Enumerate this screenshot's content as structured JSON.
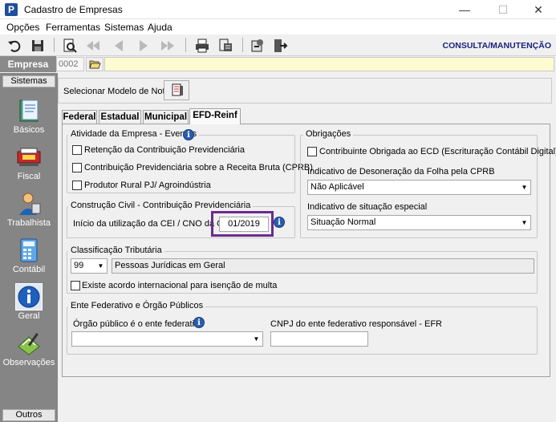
{
  "window": {
    "title": "Cadastro de Empresas",
    "app_icon_letter": "P",
    "minimize": "—",
    "maximize": "☐",
    "close": "✕"
  },
  "menu": {
    "items": [
      "Opções",
      "Ferramentas",
      "Sistemas",
      "Ajuda"
    ]
  },
  "toolbar": {
    "mode_label": "CONSULTA/MANUTENÇÃO"
  },
  "empresa": {
    "label": "Empresa",
    "code": "0002",
    "name": ""
  },
  "sidebar": {
    "header": "Sistemas",
    "footer": "Outros",
    "items": [
      {
        "label": "Básicos",
        "icon": "book-icon"
      },
      {
        "label": "Fiscal",
        "icon": "fiscal-icon"
      },
      {
        "label": "Trabalhista",
        "icon": "worker-icon"
      },
      {
        "label": "Contábil",
        "icon": "calculator-icon"
      },
      {
        "label": "Geral",
        "icon": "info-icon"
      },
      {
        "label": "Observações",
        "icon": "notes-icon"
      }
    ]
  },
  "modelo": {
    "label": "Selecionar Modelo de Nota"
  },
  "tabs": [
    {
      "label": "Federal"
    },
    {
      "label": "Estadual"
    },
    {
      "label": "Municipal"
    },
    {
      "label": "EFD-Reinf"
    }
  ],
  "atividade": {
    "title": "Atividade da Empresa - Eventos",
    "options": [
      "Retenção da Contribuição Previdenciária",
      "Contribuição Previdenciária sobre a Receita Bruta (CPRB)",
      "Produtor Rural PJ/ Agroindústria"
    ]
  },
  "construcao": {
    "title": "Construção Civil - Contribuição Previdenciária",
    "label": "Início da utilização da CEI / CNO da Obra",
    "value": "01/2019"
  },
  "obrigacoes": {
    "title": "Obrigações",
    "ecd_label": "Contribuinte Obrigada ao ECD (Escrituração Contábil Digital)",
    "desoneracao_label": "Indicativo de Desoneração da Folha pela CPRB",
    "desoneracao_value": "Não Aplicável",
    "situacao_label": "Indicativo de situação especial",
    "situacao_value": "Situação Normal"
  },
  "classificacao": {
    "title": "Classificação Tributária",
    "code": "99",
    "description": "Pessoas Jurídicas em Geral",
    "acordo_label": "Existe acordo internacional para isenção de multa"
  },
  "ente": {
    "title": "Ente Federativo e Órgão Públicos",
    "orgao_label": "Órgão público é o ente federativo",
    "orgao_value": "",
    "cnpj_label": "CNPJ do ente federativo responsável - EFR",
    "cnpj_value": ""
  }
}
